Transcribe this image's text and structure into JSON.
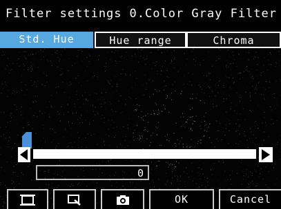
{
  "header": {
    "title": "Filter settings",
    "filter_name": "0.Color Gray Filter"
  },
  "tabs": [
    {
      "label": "Std. Hue",
      "active": true
    },
    {
      "label": "Hue range",
      "active": false
    },
    {
      "label": "Chroma",
      "active": false
    }
  ],
  "slider": {
    "value_fraction": 0.0
  },
  "value_field": {
    "value": "0"
  },
  "buttons": {
    "frame_icon": "frame-select-icon",
    "zoom_icon": "zoom-icon",
    "capture_icon": "camera-icon",
    "ok_label": "OK",
    "cancel_label": "Cancel"
  },
  "colors": {
    "active_tab": "#58a8e0",
    "slider_thumb": "#4a90d9"
  }
}
